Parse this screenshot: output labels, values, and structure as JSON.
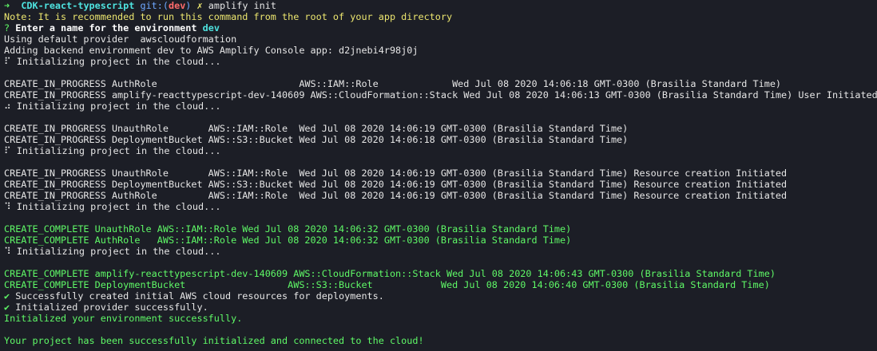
{
  "colors": {
    "background": "#1c1e26",
    "text": "#e6e6e6",
    "green": "#5ff967",
    "cyan": "#4ee3e0",
    "magenta": "#d66bd8",
    "red": "#ff6b6b",
    "yellow": "#ece66f",
    "blue": "#6fa8ff"
  },
  "lines": [
    [
      {
        "text": "➜  ",
        "style": "bold-green"
      },
      {
        "text": "CDK-react-typescript",
        "style": "cyan-bold"
      },
      {
        "text": " git:(",
        "style": "blue"
      },
      {
        "text": "dev",
        "style": "red-bold"
      },
      {
        "text": ") ",
        "style": "blue"
      },
      {
        "text": "✗ ",
        "style": "yellow"
      },
      {
        "text": "amplify init",
        "style": "default"
      }
    ],
    [
      {
        "text": "Note: It is recommended to run this command from the root of your app directory",
        "style": "yellow"
      }
    ],
    [
      {
        "text": "? ",
        "style": "green"
      },
      {
        "text": "Enter a name for the environment ",
        "style": "white-bold"
      },
      {
        "text": "dev",
        "style": "cyan-bold"
      }
    ],
    [
      {
        "text": "Using default provider  awscloudformation",
        "style": "default"
      }
    ],
    [
      {
        "text": "Adding backend environment dev to AWS Amplify Console app: d2jnebi4r98j0j",
        "style": "default"
      }
    ],
    [
      {
        "text": "⠏ Initializing project in the cloud...",
        "style": "default"
      }
    ],
    [
      {
        "text": "",
        "style": "default"
      }
    ],
    [
      {
        "text": "CREATE_IN_PROGRESS AuthRole                         AWS::IAM::Role             Wed Jul 08 2020 14:06:18 GMT-0300 (Brasilia Standard Time)",
        "style": "default"
      }
    ],
    [
      {
        "text": "CREATE_IN_PROGRESS amplify-reacttypescript-dev-140609 AWS::CloudFormation::Stack Wed Jul 08 2020 14:06:13 GMT-0300 (Brasilia Standard Time) User Initiated",
        "style": "default"
      }
    ],
    [
      {
        "text": "⠴ Initializing project in the cloud...",
        "style": "default"
      }
    ],
    [
      {
        "text": "",
        "style": "default"
      }
    ],
    [
      {
        "text": "CREATE_IN_PROGRESS UnauthRole       AWS::IAM::Role  Wed Jul 08 2020 14:06:19 GMT-0300 (Brasilia Standard Time)",
        "style": "default"
      }
    ],
    [
      {
        "text": "CREATE_IN_PROGRESS DeploymentBucket AWS::S3::Bucket Wed Jul 08 2020 14:06:18 GMT-0300 (Brasilia Standard Time)",
        "style": "default"
      }
    ],
    [
      {
        "text": "⠏ Initializing project in the cloud...",
        "style": "default"
      }
    ],
    [
      {
        "text": "",
        "style": "default"
      }
    ],
    [
      {
        "text": "CREATE_IN_PROGRESS UnauthRole       AWS::IAM::Role  Wed Jul 08 2020 14:06:19 GMT-0300 (Brasilia Standard Time) Resource creation Initiated",
        "style": "default"
      }
    ],
    [
      {
        "text": "CREATE_IN_PROGRESS DeploymentBucket AWS::S3::Bucket Wed Jul 08 2020 14:06:19 GMT-0300 (Brasilia Standard Time) Resource creation Initiated",
        "style": "default"
      }
    ],
    [
      {
        "text": "CREATE_IN_PROGRESS AuthRole         AWS::IAM::Role  Wed Jul 08 2020 14:06:19 GMT-0300 (Brasilia Standard Time) Resource creation Initiated",
        "style": "default"
      }
    ],
    [
      {
        "text": "⠹ Initializing project in the cloud...",
        "style": "default"
      }
    ],
    [
      {
        "text": "",
        "style": "default"
      }
    ],
    [
      {
        "text": "CREATE_COMPLETE UnauthRole AWS::IAM::Role Wed Jul 08 2020 14:06:32 GMT-0300 (Brasilia Standard Time)",
        "style": "green"
      }
    ],
    [
      {
        "text": "CREATE_COMPLETE AuthRole   AWS::IAM::Role Wed Jul 08 2020 14:06:32 GMT-0300 (Brasilia Standard Time)",
        "style": "green"
      }
    ],
    [
      {
        "text": "⠹ Initializing project in the cloud...",
        "style": "default"
      }
    ],
    [
      {
        "text": "",
        "style": "default"
      }
    ],
    [
      {
        "text": "CREATE_COMPLETE amplify-reacttypescript-dev-140609 AWS::CloudFormation::Stack Wed Jul 08 2020 14:06:43 GMT-0300 (Brasilia Standard Time)",
        "style": "green"
      }
    ],
    [
      {
        "text": "CREATE_COMPLETE DeploymentBucket                  AWS::S3::Bucket            Wed Jul 08 2020 14:06:40 GMT-0300 (Brasilia Standard Time)",
        "style": "green"
      }
    ],
    [
      {
        "text": "✔",
        "style": "green"
      },
      {
        "text": " Successfully created initial AWS cloud resources for deployments.",
        "style": "default"
      }
    ],
    [
      {
        "text": "✔",
        "style": "green"
      },
      {
        "text": " Initialized provider successfully.",
        "style": "default"
      }
    ],
    [
      {
        "text": "Initialized your environment successfully.",
        "style": "green"
      }
    ],
    [
      {
        "text": "",
        "style": "default"
      }
    ],
    [
      {
        "text": "Your project has been successfully initialized and connected to the cloud!",
        "style": "green"
      }
    ]
  ]
}
